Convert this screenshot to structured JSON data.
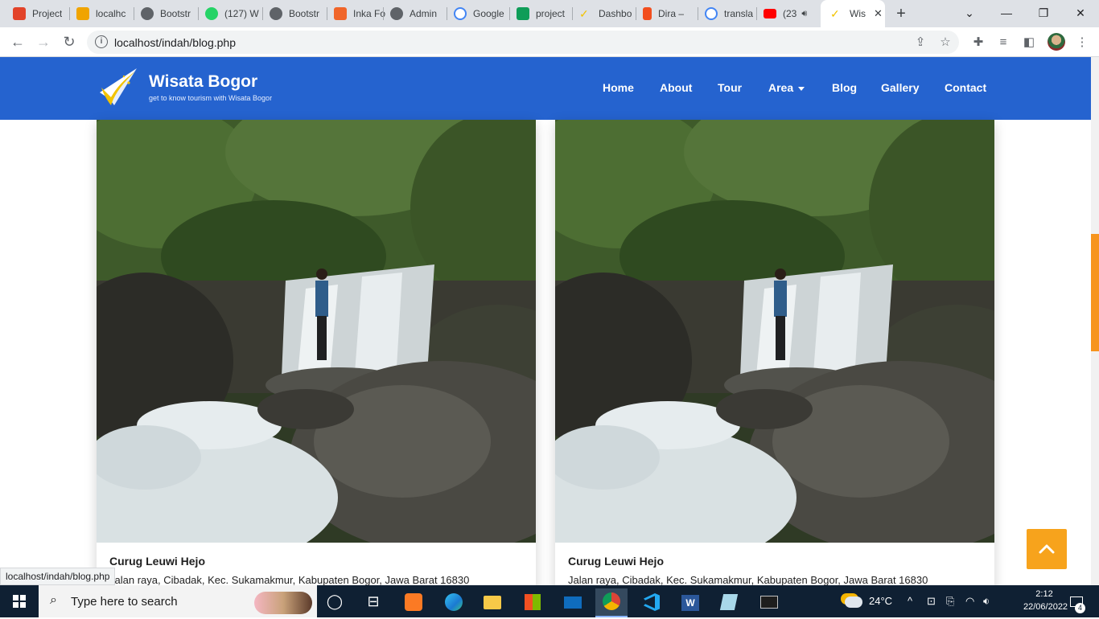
{
  "browser": {
    "tabs": [
      {
        "title": "Project",
        "color": "#e24329"
      },
      {
        "title": "localhc",
        "color": "#f0a400"
      },
      {
        "title": "Bootstr",
        "color": "#5f6368"
      },
      {
        "title": "(127) W",
        "color": "#25d366"
      },
      {
        "title": "Bootstr",
        "color": "#5f6368"
      },
      {
        "title": "Inka Fo",
        "color": "#f06529"
      },
      {
        "title": "Admin",
        "color": "#5f6368"
      },
      {
        "title": "Google",
        "color": "#4285f4"
      },
      {
        "title": "project",
        "color": "#0f9d58"
      },
      {
        "title": "Dashbo",
        "color": "#f2c300"
      },
      {
        "title": "Dira –",
        "color": "#f24e1e"
      },
      {
        "title": "transla",
        "color": "#4285f4"
      },
      {
        "title": "(23",
        "color": "#ff0000"
      }
    ],
    "active_tab": {
      "title": "Wis",
      "close": "✕"
    },
    "new_tab": "+",
    "window_controls": {
      "menu": "⌄",
      "minimize": "—",
      "restore": "❐",
      "close": "✕"
    },
    "url": "localhost/indah/blog.php",
    "info_glyph": "i",
    "status_url": "localhost/indah/blog.php"
  },
  "site": {
    "brand_title": "Wisata Bogor",
    "brand_subtitle": "get to know tourism with Wisata Bogor",
    "nav": [
      "Home",
      "About",
      "Tour",
      "Area",
      "Blog",
      "Gallery",
      "Contact"
    ],
    "accent": "#2563cf",
    "cards": [
      {
        "title": "Curug Leuwi Hejo",
        "address": "Jalan raya, Cibadak, Kec. Sukamakmur, Kabupaten Bogor, Jawa Barat 16830"
      },
      {
        "title": "Curug Leuwi Hejo",
        "address": "Jalan raya, Cibadak, Kec. Sukamakmur, Kabupaten Bogor, Jawa Barat 16830"
      }
    ],
    "back_to_top_color": "#f7a31c"
  },
  "taskbar": {
    "search_placeholder": "Type here to search",
    "weather": "24°C",
    "time": "2:12",
    "date": "22/06/2022",
    "notifications": "4"
  }
}
